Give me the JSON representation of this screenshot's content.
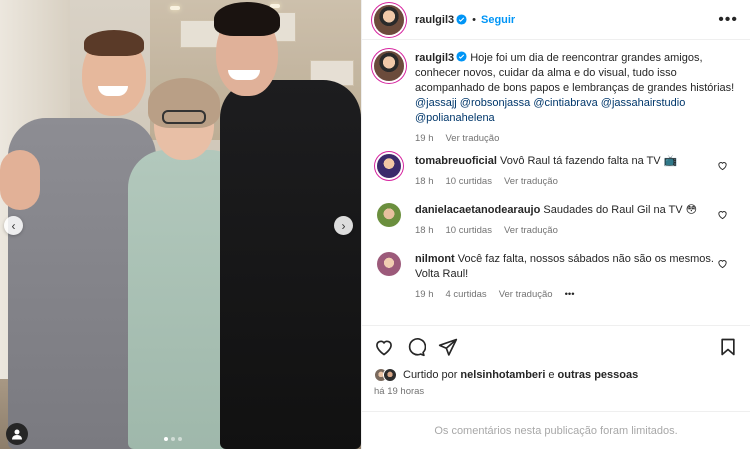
{
  "post": {
    "author": "raulgil3",
    "follow_label": "Seguir",
    "caption_text": "Hoje foi um dia de reencontrar grandes amigos, conhecer novos, cuidar da alma e do visual, tudo isso acompanhado de bons papos e lembranças de grandes histórias!",
    "mentions": [
      "@jassajj",
      "@robsonjassa",
      "@cintiabrava",
      "@jassahairstudio",
      "@polianahelena"
    ],
    "caption_age": "19 h",
    "translate_label": "Ver tradução"
  },
  "comments": [
    {
      "user": "tomabreuoficial",
      "text": "Vovô Raul tá fazendo falta na TV 📺",
      "age": "18 h",
      "likes": "10 curtidas",
      "translate": "Ver tradução"
    },
    {
      "user": "danielacaetanodearaujo",
      "text": "Saudades do Raul Gil na TV 😳",
      "age": "18 h",
      "likes": "10 curtidas",
      "translate": "Ver tradução"
    },
    {
      "user": "nilmont",
      "text": "Você faz falta, nossos sábados não são os mesmos. Volta Raul!",
      "age": "19 h",
      "likes": "4 curtidas",
      "translate": "Ver tradução",
      "more": "•••"
    }
  ],
  "likes_bar": {
    "prefix": "Curtido por",
    "user": "nelsinhotamberi",
    "connector": "e",
    "others": "outras pessoas"
  },
  "timestamp": "há 19 horas",
  "limited_notice": "Os comentários nesta publicação foram limitados.",
  "carousel": {
    "total": 3,
    "active": 0
  },
  "icons": {
    "verified": "verified-badge-icon",
    "more": "more-options-icon",
    "heart": "heart-icon",
    "comment": "comment-icon",
    "share": "share-icon",
    "save": "bookmark-icon",
    "tag": "user-tag-icon",
    "prev": "chevron-left-icon",
    "next": "chevron-right-icon"
  },
  "colors": {
    "link": "#00376b",
    "follow": "#0095f6",
    "muted": "#737373",
    "verified": "#0095f6"
  }
}
